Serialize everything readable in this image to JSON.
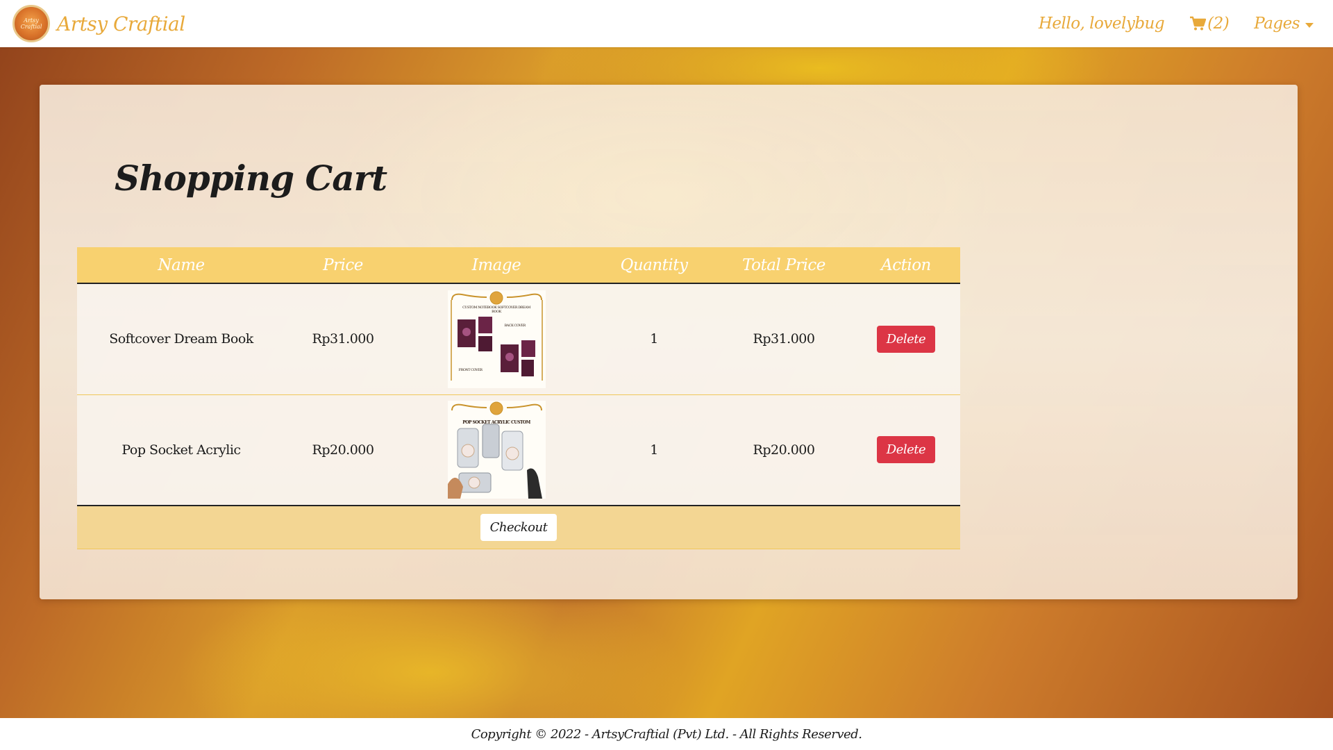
{
  "navbar": {
    "brand_name": "Artsy Craftial",
    "logo_text": "Artsy Craftial",
    "greeting": "Hello, lovelybug",
    "cart_count": "(2)",
    "pages_label": "Pages"
  },
  "main": {
    "title": "Shopping Cart",
    "table": {
      "headers": {
        "name": "Name",
        "price": "Price",
        "image": "Image",
        "quantity": "Quantity",
        "total_price": "Total Price",
        "action": "Action"
      },
      "rows": [
        {
          "name": "Softcover Dream Book",
          "price": "Rp31.000",
          "quantity": "1",
          "total_price": "Rp31.000",
          "action_label": "Delete",
          "image_text": {
            "heading": "CUSTOM NOTEBOOK SOFTCOVER DREAM BOOK",
            "back": "BACK COVER",
            "front": "FRONT COVER"
          }
        },
        {
          "name": "Pop Socket Acrylic",
          "price": "Rp20.000",
          "quantity": "1",
          "total_price": "Rp20.000",
          "action_label": "Delete",
          "image_text": {
            "heading": "POP SOCKET ACRYLIC CUSTOM"
          }
        }
      ],
      "checkout_label": "Checkout"
    }
  },
  "footer": {
    "copyright": "Copyright © 2022 - ArtsyCraftial (Pvt) Ltd. - All Rights Reserved."
  },
  "colors": {
    "brand": "#e8a93a",
    "table_header": "#f8d16f",
    "delete": "#dc3545"
  }
}
